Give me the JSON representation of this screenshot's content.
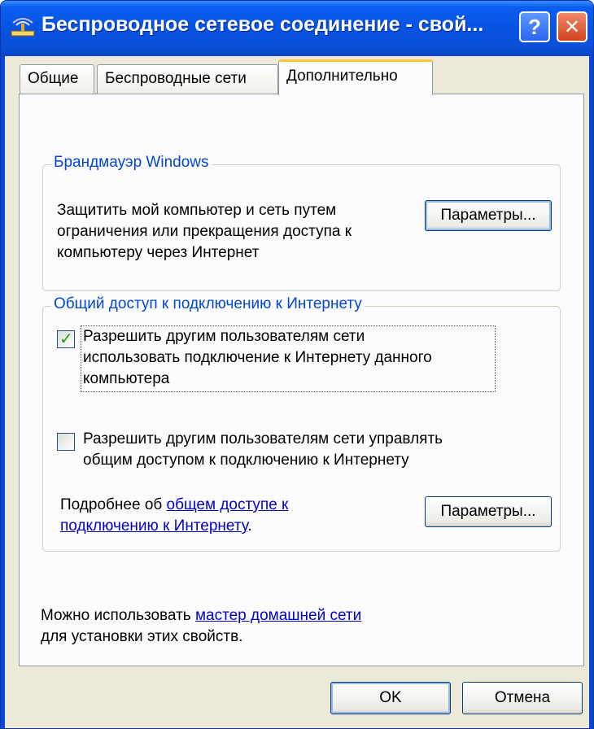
{
  "window": {
    "title": "Беспроводное сетевое соединение - свой...",
    "help_label": "?",
    "close_label": "✕"
  },
  "tabs": [
    {
      "label": "Общие"
    },
    {
      "label": "Беспроводные сети"
    },
    {
      "label": "Дополнительно"
    }
  ],
  "firewall": {
    "title": "Брандмауэр Windows",
    "description_line1": "Защитить мой компьютер и сеть путем",
    "description_line2": "ограничения или прекращения доступа к",
    "description_line3": "компьютеру через Интернет",
    "settings_button": "Параметры..."
  },
  "ics": {
    "title": "Общий доступ к подключению к Интернету",
    "allow_share": {
      "checked": true,
      "line1": "Разрешить другим пользователям сети",
      "line2": "использовать подключение к Интернету данного",
      "line3": "компьютера"
    },
    "allow_control": {
      "checked": false,
      "line1": "Разрешить другим пользователям сети управлять",
      "line2": "общим доступом к подключению к Интернету"
    },
    "more_prefix": "Подробнее об ",
    "more_link_line1": "общем доступе к",
    "more_link_line2": "подключению к Интернету",
    "more_suffix": ".",
    "settings_button": "Параметры..."
  },
  "footer": {
    "wizard_prefix": "Можно использовать ",
    "wizard_link": "мастер домашней сети",
    "wizard_suffix": "для установки этих свойств."
  },
  "buttons": {
    "ok": "OK",
    "cancel": "Отмена"
  },
  "colors": {
    "title_bar": "#0a5ef0",
    "group_title": "#0046d5",
    "link": "#0000cc",
    "tab_active_accent": "#ffc83c"
  }
}
